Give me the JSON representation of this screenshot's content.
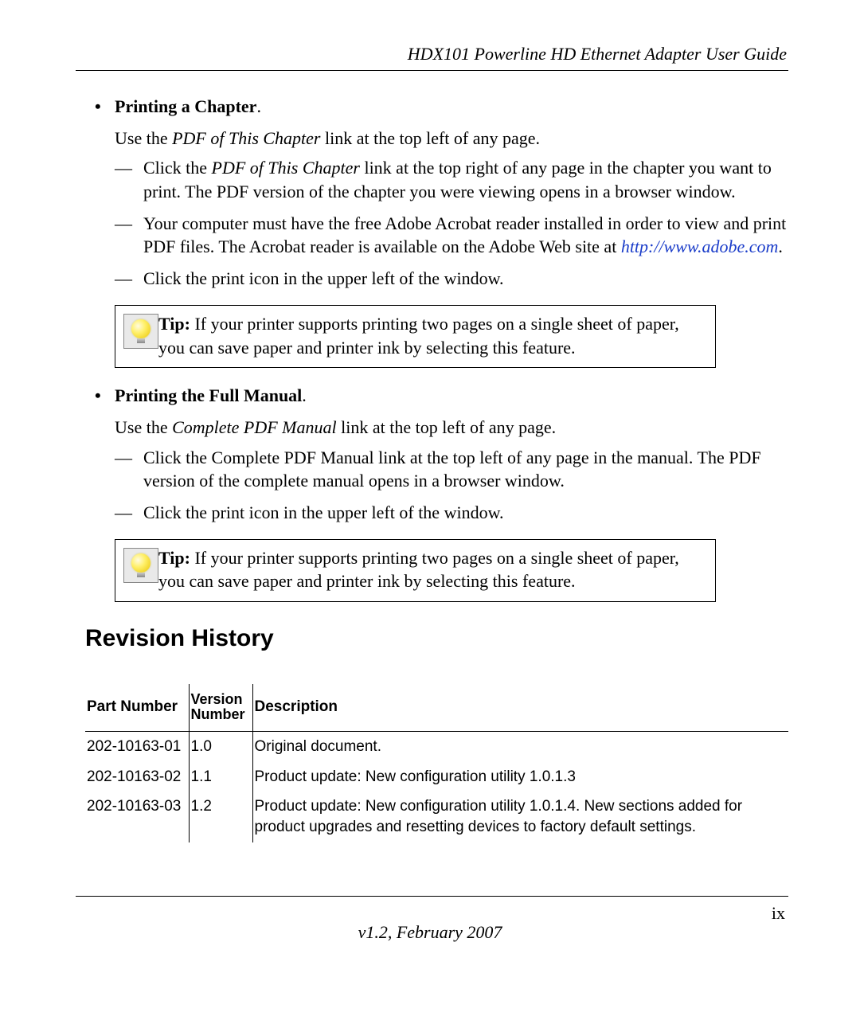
{
  "running_head": "HDX101 Powerline HD Ethernet Adapter User Guide",
  "section_a": {
    "title": "Printing a Chapter",
    "period": ".",
    "intro_pre": "Use the ",
    "intro_em": "PDF of This Chapter",
    "intro_post": " link at the top left of any page.",
    "d1_pre": "Click the ",
    "d1_em": "PDF of This Chapter",
    "d1_post": " link at the top right of any page in the chapter you want to print. The PDF version of the chapter you were viewing opens in a browser window.",
    "d2_text": "Your computer must have the free Adobe Acrobat reader installed in order to view and print PDF files. The Acrobat reader is available on the Adobe Web site at ",
    "d2_link": "http://www.adobe.com",
    "d2_tail": ".",
    "d3_text": "Click the print icon in the upper left of the window."
  },
  "tip1": {
    "label": "Tip:",
    "text": " If your printer supports printing two pages on a single sheet of paper, you can save paper and printer ink by selecting this feature."
  },
  "section_b": {
    "title": "Printing the Full Manual",
    "period": ".",
    "intro_pre": "Use the ",
    "intro_em": "Complete PDF Manual",
    "intro_post": " link at the top left of any page.",
    "d1_text": "Click the Complete PDF Manual link at the top left of any page in the manual. The PDF version of the complete manual opens in a browser window.",
    "d2_text": "Click the print icon in the upper left of the window."
  },
  "tip2": {
    "label": "Tip:",
    "text": " If your printer supports printing two pages on a single sheet of paper, you can save paper and printer ink by selecting this feature."
  },
  "rev_heading": "Revision History",
  "rev_table": {
    "headers": {
      "part": "Part Number",
      "ver_line1": "Version",
      "ver_line2": "Number",
      "desc": "Description"
    },
    "rows": [
      {
        "part": "202-10163-01",
        "ver": "1.0",
        "desc": "Original document."
      },
      {
        "part": "202-10163-02",
        "ver": "1.1",
        "desc": "Product update: New configuration utility 1.0.1.3"
      },
      {
        "part": "202-10163-03",
        "ver": "1.2",
        "desc": "Product update: New configuration utility 1.0.1.4. New sections added for product upgrades and resetting devices to factory default settings."
      }
    ]
  },
  "page_number": "ix",
  "page_footer": "v1.2, February 2007"
}
